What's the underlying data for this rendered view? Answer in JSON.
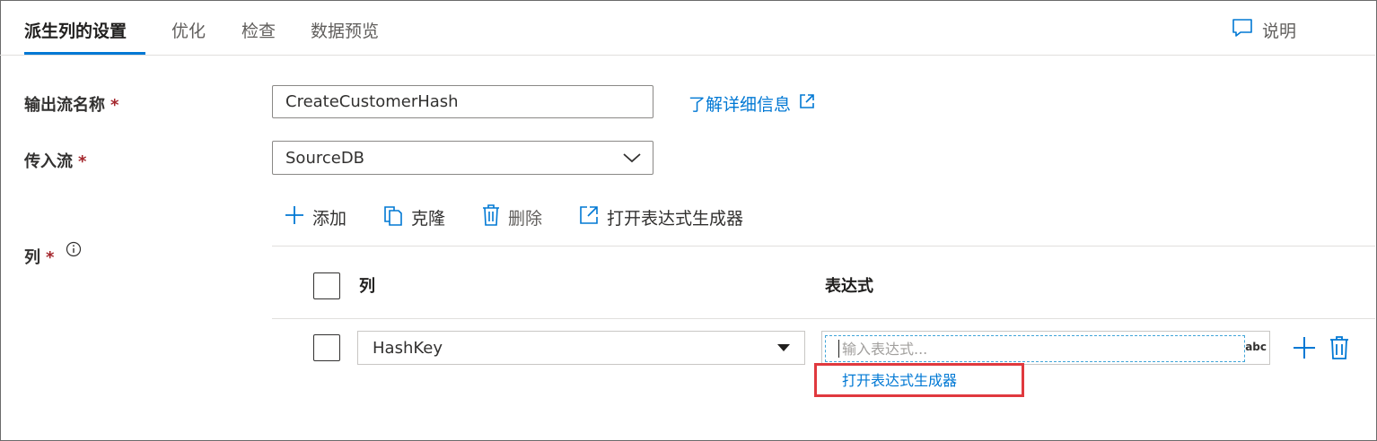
{
  "tabs": [
    {
      "label": "派生列的设置",
      "active": true
    },
    {
      "label": "优化",
      "active": false
    },
    {
      "label": "检查",
      "active": false
    },
    {
      "label": "数据预览",
      "active": false
    }
  ],
  "help": {
    "label": "说明",
    "icon": "comment-icon"
  },
  "output_stream": {
    "label": "输出流名称",
    "required_mark": "*",
    "value": "CreateCustomerHash"
  },
  "learn_more": {
    "label": "了解详细信息",
    "icon": "external-link-icon"
  },
  "incoming_stream": {
    "label": "传入流",
    "required_mark": "*",
    "value": "SourceDB"
  },
  "toolbar": {
    "add_label": "添加",
    "clone_label": "克隆",
    "delete_label": "删除",
    "open_builder_label": "打开表达式生成器"
  },
  "columns_section": {
    "label": "列",
    "required_mark": "*",
    "info_icon": "info-icon"
  },
  "grid": {
    "headers": {
      "column": "列",
      "expression": "表达式"
    },
    "rows": [
      {
        "column": "HashKey",
        "expression": "",
        "expression_placeholder": "输入表达式...",
        "type_badge": "abc"
      }
    ],
    "open_builder_hint": "打开表达式生成器"
  },
  "colors": {
    "accent": "#0078d4",
    "required": "#a4262c",
    "highlight": "#e0393e"
  }
}
